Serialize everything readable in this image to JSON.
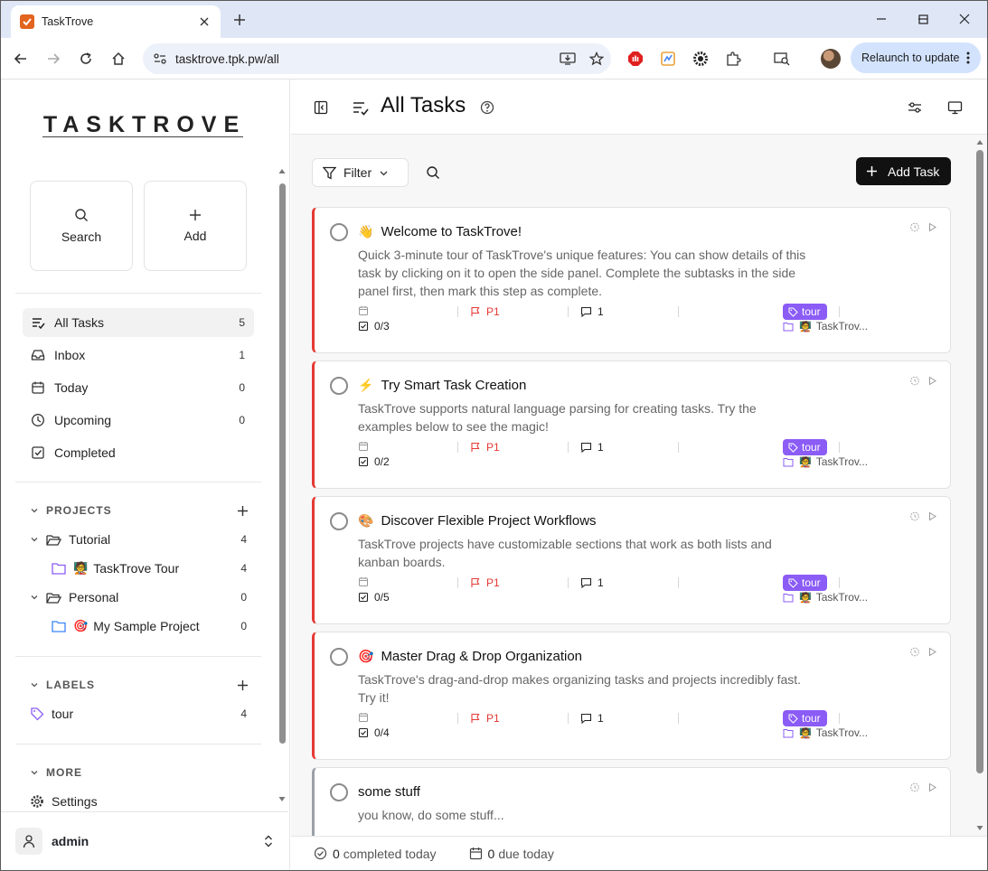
{
  "browser": {
    "tab_title": "TaskTrove",
    "url": "tasktrove.tpk.pw/all",
    "relaunch_label": "Relaunch to update"
  },
  "sidebar": {
    "brand": "TASKTROVE",
    "quick_actions": [
      {
        "label": "Search",
        "icon": "search-icon"
      },
      {
        "label": "Add",
        "icon": "plus-icon"
      }
    ],
    "nav": [
      {
        "label": "All Tasks",
        "count": "5",
        "icon": "list-icon",
        "active": true
      },
      {
        "label": "Inbox",
        "count": "1",
        "icon": "inbox-icon"
      },
      {
        "label": "Today",
        "count": "0",
        "icon": "calendar-icon"
      },
      {
        "label": "Upcoming",
        "count": "0",
        "icon": "clock-icon"
      },
      {
        "label": "Completed",
        "count": "",
        "icon": "check-square-icon"
      }
    ],
    "projects_header": "PROJECTS",
    "projects": [
      {
        "label": "Tutorial",
        "count": "4",
        "level": 0
      },
      {
        "label": "TaskTrove Tour",
        "count": "4",
        "level": 1,
        "emoji": "🧑‍🏫"
      },
      {
        "label": "Personal",
        "count": "0",
        "level": 0
      },
      {
        "label": "My Sample Project",
        "count": "0",
        "level": 1,
        "emoji": "🎯"
      }
    ],
    "labels_header": "LABELS",
    "labels": [
      {
        "label": "tour",
        "count": "4"
      }
    ],
    "more_header": "MORE",
    "more": [
      {
        "label": "Settings"
      }
    ],
    "user": {
      "name": "admin"
    }
  },
  "main": {
    "title": "All Tasks",
    "filter_label": "Filter",
    "add_task_label": "Add Task",
    "tasks": [
      {
        "emoji": "👋",
        "title": "Welcome to TaskTrove!",
        "desc": "Quick 3-minute tour of TaskTrove's unique features: You can show details of this task by clicking on it to open the side panel. Complete the subtasks in the side panel first, then mark this step as complete.",
        "subtasks": "0/3",
        "priority": "P1",
        "comments": "1",
        "tag": "tour",
        "project": "TaskTrov...",
        "project_emoji": "🧑‍🏫"
      },
      {
        "emoji": "⚡",
        "title": "Try Smart Task Creation",
        "desc": "TaskTrove supports natural language parsing for creating tasks. Try the examples below to see the magic!",
        "subtasks": "0/2",
        "priority": "P1",
        "comments": "1",
        "tag": "tour",
        "project": "TaskTrov...",
        "project_emoji": "🧑‍🏫"
      },
      {
        "emoji": "🎨",
        "title": "Discover Flexible Project Workflows",
        "desc": "TaskTrove projects have customizable sections that work as both lists and kanban boards.",
        "subtasks": "0/5",
        "priority": "P1",
        "comments": "1",
        "tag": "tour",
        "project": "TaskTrov...",
        "project_emoji": "🧑‍🏫"
      },
      {
        "emoji": "🎯",
        "title": "Master Drag & Drop Organization",
        "desc": "TaskTrove's drag-and-drop makes organizing tasks and projects incredibly fast. Try it!",
        "subtasks": "0/4",
        "priority": "P1",
        "comments": "1",
        "tag": "tour",
        "project": "TaskTrov...",
        "project_emoji": "🧑‍🏫"
      },
      {
        "emoji": "",
        "title": "some stuff",
        "desc": "you know, do some stuff..."
      }
    ]
  },
  "status": {
    "completed_count": "0",
    "completed_label": "completed today",
    "due_count": "0",
    "due_label": "due today"
  }
}
